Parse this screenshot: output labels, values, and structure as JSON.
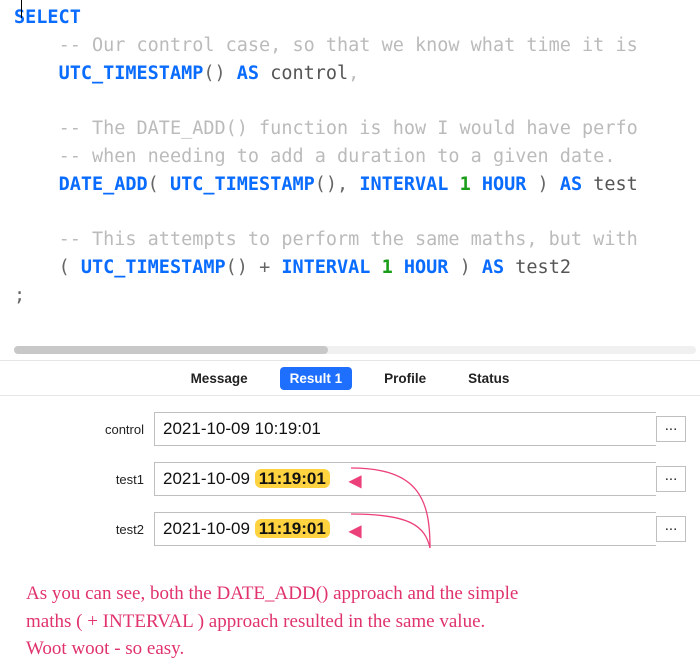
{
  "code": {
    "select": "SELECT",
    "comment1": "-- Our control case, so that we know what time it is",
    "line_control_fn": "UTC_TIMESTAMP",
    "line_control_as": "AS",
    "line_control_alias": "control",
    "comment2a": "-- The DATE_ADD() function is how I would have perfo",
    "comment2b": "-- when needing to add a duration to a given date.",
    "fn_date_add": "DATE_ADD",
    "fn_utc": "UTC_TIMESTAMP",
    "kw_interval": "INTERVAL",
    "num_one": "1",
    "kw_hour": "HOUR",
    "kw_as": "AS",
    "alias1": "test",
    "comment3": "-- This attempts to perform the same maths, but with",
    "alias2": "test2",
    "terminator": ";"
  },
  "tabs": {
    "message": "Message",
    "result1": "Result 1",
    "profile": "Profile",
    "status": "Status"
  },
  "results": {
    "rows": [
      {
        "label": "control",
        "prefix": "2021-10-09 10:19:01",
        "highlight": "",
        "arrow": false
      },
      {
        "label": "test1",
        "prefix": "2021-10-09 ",
        "highlight": "11:19:01",
        "arrow": true
      },
      {
        "label": "test2",
        "prefix": "2021-10-09 ",
        "highlight": "11:19:01",
        "arrow": true
      }
    ],
    "ellipsis": "..."
  },
  "annotation": {
    "line1": "As you can see, both the DATE_ADD() approach and the simple",
    "line2": "maths ( + INTERVAL ) approach resulted in the same value.",
    "line3": "Woot woot - so easy."
  }
}
